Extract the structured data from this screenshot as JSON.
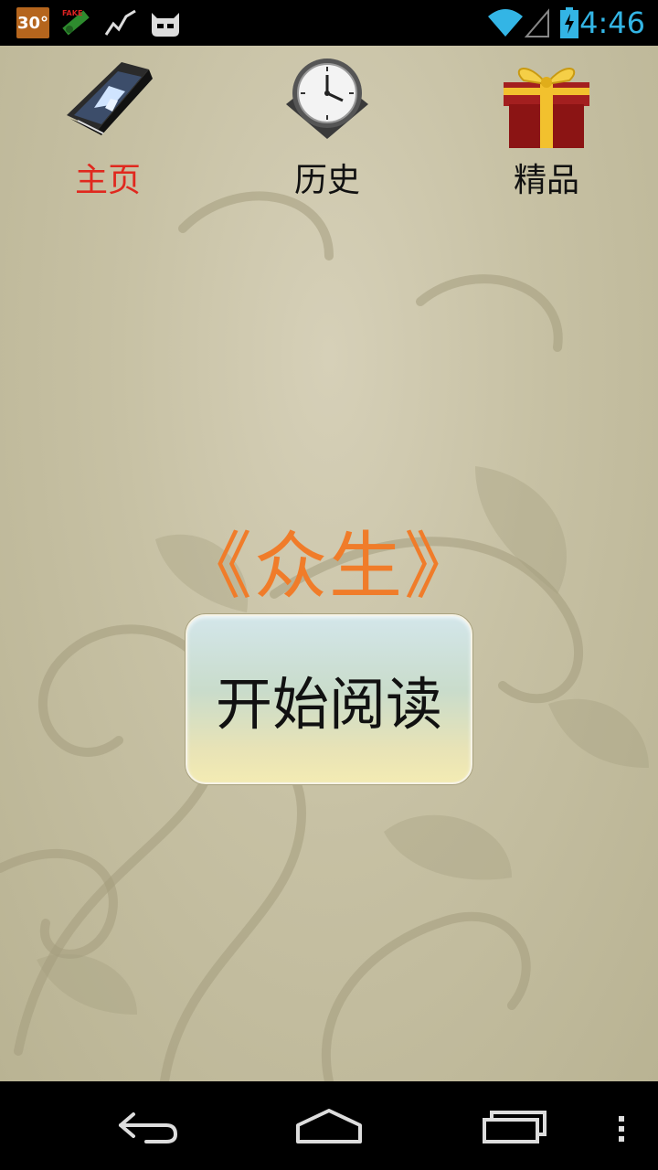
{
  "status_bar": {
    "temperature": "30°",
    "time": "4:46",
    "icons": [
      "weather-temp-icon",
      "fake-gps-icon",
      "activity-graph-icon",
      "cyanogen-mascot-icon",
      "wifi-icon",
      "cell-signal-icon",
      "battery-charging-icon"
    ]
  },
  "tabs": [
    {
      "label": "主页",
      "icon": "home-book-icon",
      "active": true
    },
    {
      "label": "历史",
      "icon": "clock-icon",
      "active": false
    },
    {
      "label": "精品",
      "icon": "gift-box-icon",
      "active": false
    }
  ],
  "book": {
    "title": "《众生》"
  },
  "read_button": {
    "label": "开始阅读"
  },
  "colors": {
    "active_tab": "#e0281e",
    "title": "#f07c2a",
    "time": "#33b5e5"
  },
  "nav_bar": {
    "buttons": [
      "back-icon",
      "home-icon",
      "recent-apps-icon",
      "menu-icon"
    ]
  }
}
